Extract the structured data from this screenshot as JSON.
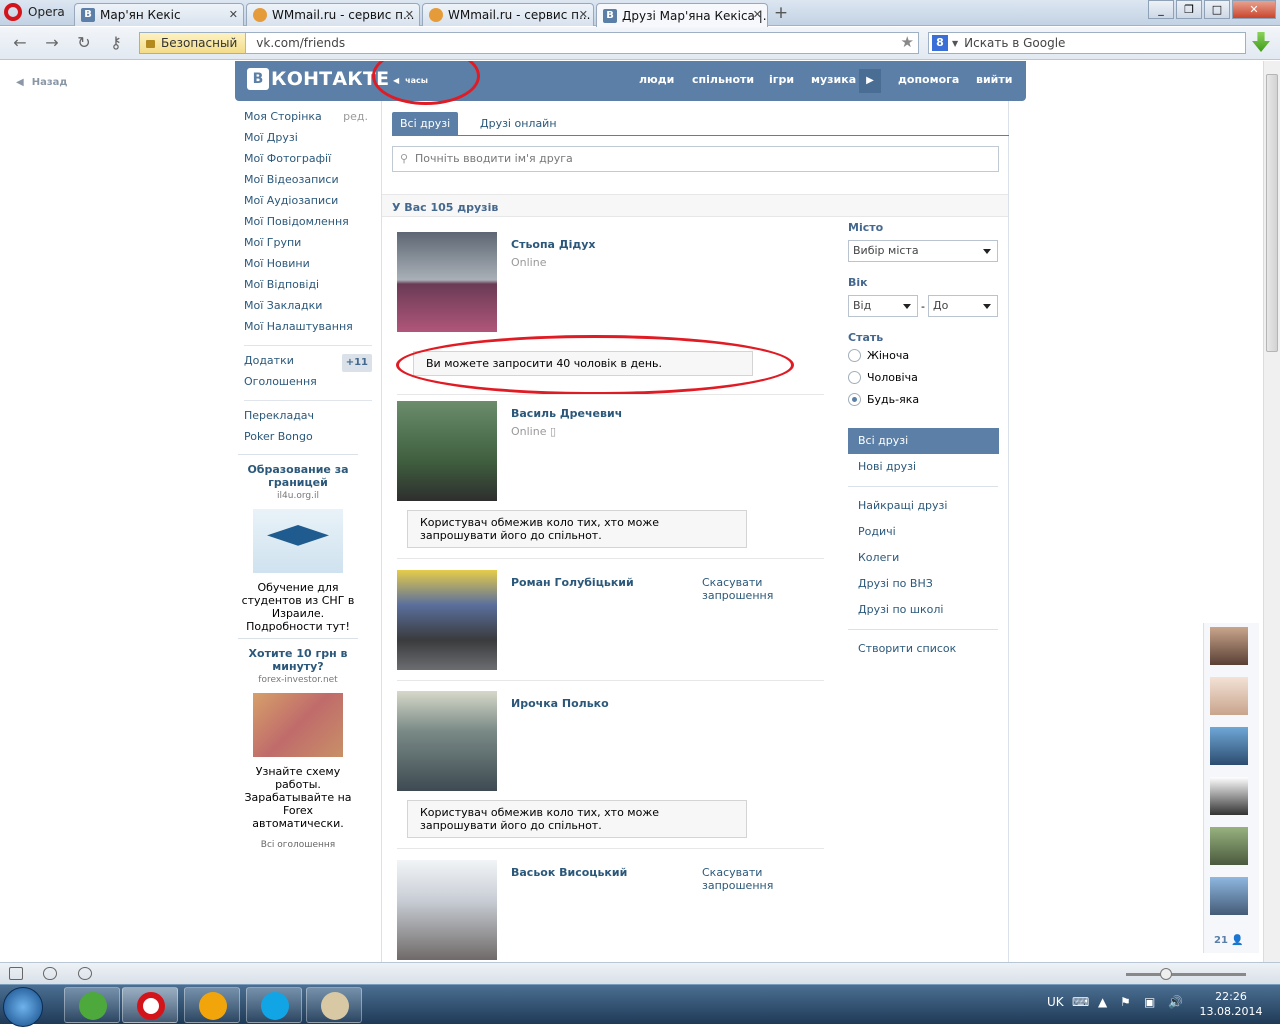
{
  "browser": {
    "menu_label": "Opera",
    "tabs": [
      {
        "title": "Мар'ян Кекіс",
        "icon": "vk-favicon"
      },
      {
        "title": "WMmail.ru - сервис п...",
        "icon": "wmmail-favicon"
      },
      {
        "title": "WMmail.ru - сервис п...",
        "icon": "wmmail-favicon"
      },
      {
        "title": "Друзі Мар'яна Кекіса |...",
        "icon": "vk-favicon",
        "active": true
      }
    ],
    "security_label": "Безопасный",
    "address": "vk.com/friends",
    "search_placeholder": "Искать в Google",
    "search_engine_icon": "8"
  },
  "page": {
    "back_label": "Назад",
    "header": {
      "logo_letter": "В",
      "logo_text": "КОНТАКТЕ",
      "hours_label": "часы",
      "nav": [
        "люди",
        "спільноти",
        "ігри",
        "музика",
        "допомога",
        "вийти"
      ]
    },
    "left_menu": {
      "items": [
        {
          "label": "Моя Сторінка",
          "extra": "ред."
        },
        {
          "label": "Мої Друзі"
        },
        {
          "label": "Мої Фотографії"
        },
        {
          "label": "Мої Відеозаписи"
        },
        {
          "label": "Мої Аудіозаписи"
        },
        {
          "label": "Мої Повідомлення"
        },
        {
          "label": "Мої Групи"
        },
        {
          "label": "Мої Новини"
        },
        {
          "label": "Мої Відповіді"
        },
        {
          "label": "Мої Закладки"
        },
        {
          "label": "Мої Налаштування"
        }
      ],
      "apps_label": "Додатки",
      "apps_badge": "+11",
      "ads_label": "Оголошення",
      "extra_items": [
        "Перекладач",
        "Poker Bongo"
      ]
    },
    "ads": [
      {
        "title": "Образование за границей",
        "domain": "il4u.org.il",
        "text": "Обучение для студентов из СНГ в Израиле. Подробности тут!"
      },
      {
        "title": "Хотите 10 грн в минуту?",
        "domain": "forex-investor.net",
        "text": "Узнайте схему работы. Зарабатывайте на Forex автоматически."
      }
    ],
    "all_ads_label": "Всі оголошення",
    "tabs": [
      "Всі друзі",
      "Друзі онлайн"
    ],
    "search_placeholder": "Почніть вводити ім'я друга",
    "friends_count_text": "У Вас 105 друзів",
    "invite_limit_notice": "Ви можете запросити 40 чоловік в день.",
    "friends": [
      {
        "name": "Стьопа Дідух",
        "status": "Online"
      },
      {
        "name": "Василь Дречевич",
        "status": "Online",
        "notice": "Користувач обмежив коло тих, хто може запрошувати його до спільнот."
      },
      {
        "name": "Роман Голубіцький",
        "action": "Скасувати запрошення"
      },
      {
        "name": "Ирочка Полько",
        "notice": "Користувач обмежив коло тих, хто може запрошувати його до спільнот."
      },
      {
        "name": "Васьок Висоцький",
        "action": "Скасувати запрошення"
      }
    ],
    "filters": {
      "city_label": "Місто",
      "city_select": "Вибір міста",
      "age_label": "Вік",
      "age_from": "Від",
      "age_dash": "-",
      "age_to": "До",
      "sex_label": "Стать",
      "sex_options": [
        {
          "label": "Жіноча",
          "selected": false
        },
        {
          "label": "Чоловіча",
          "selected": false
        },
        {
          "label": "Будь-яка",
          "selected": true
        }
      ]
    },
    "right_menu": {
      "primary": [
        {
          "label": "Всі друзі",
          "active": true
        },
        {
          "label": "Нові друзі"
        }
      ],
      "secondary": [
        "Найкращі друзі",
        "Родичі",
        "Колеги",
        "Друзі по ВНЗ",
        "Друзі по школі"
      ],
      "create_list": "Створити список"
    },
    "chat_count": "21"
  },
  "taskbar": {
    "language": "UK",
    "time": "22:26",
    "date": "13.08.2014"
  },
  "colors": {
    "vk_blue": "#5b7fa6",
    "link": "#2b587a",
    "annotation_red": "#e01b24"
  }
}
